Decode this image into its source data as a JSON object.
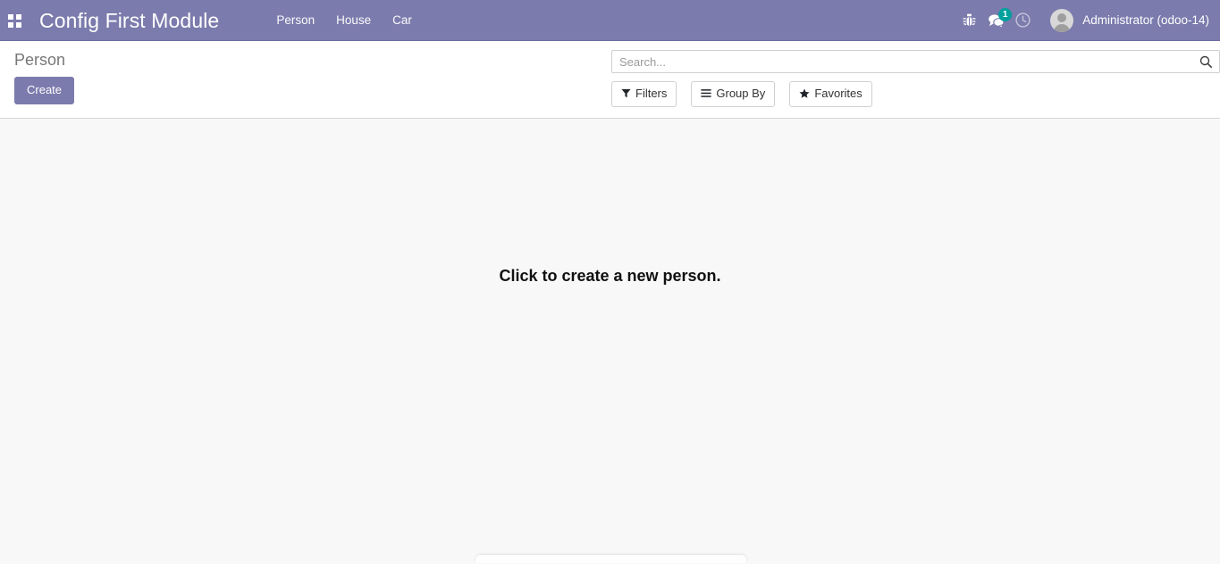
{
  "navbar": {
    "apps_icon": "apps-grid-icon",
    "brand": "Config First Module",
    "menu_items": [
      {
        "label": "Person",
        "name": "menu-item-person"
      },
      {
        "label": "House",
        "name": "menu-item-house"
      },
      {
        "label": "Car",
        "name": "menu-item-car"
      }
    ],
    "systray": {
      "debug_icon": "bug-icon",
      "messages_icon": "chat-bubbles-icon",
      "messages_badge": "1",
      "activities_icon": "clock-icon"
    },
    "user": {
      "avatar": "user-avatar",
      "name": "Administrator (odoo-14)"
    },
    "background_color": "#7c7bad"
  },
  "control_panel": {
    "breadcrumb": "Person",
    "create_label": "Create",
    "search": {
      "placeholder": "Search...",
      "value": "",
      "search_icon": "magnifier-icon"
    },
    "buttons": [
      {
        "label": "Filters",
        "icon": "filter-funnel-icon",
        "name": "filters-dropdown"
      },
      {
        "label": "Group By",
        "icon": "list-lines-icon",
        "name": "group-by-dropdown"
      },
      {
        "label": "Favorites",
        "icon": "star-icon",
        "name": "favorites-dropdown"
      }
    ]
  },
  "content": {
    "empty_message": "Click to create a new person."
  },
  "colors": {
    "brand_purple": "#7c7bad",
    "badge_teal": "#00a09d",
    "content_bg": "#f8f8f8",
    "panel_bg": "#ffffff"
  }
}
